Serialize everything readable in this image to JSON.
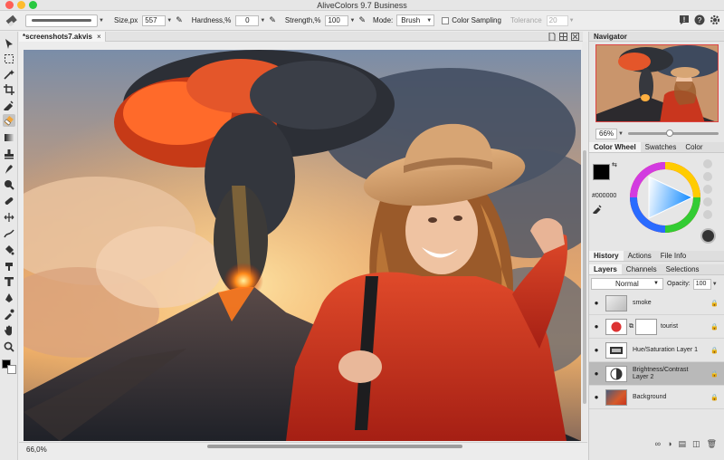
{
  "window": {
    "title": "AliveColors 9.7 Business"
  },
  "options_bar": {
    "size_label": "Size,px",
    "size_value": "557",
    "hardness_label": "Hardness,%",
    "hardness_value": "0",
    "strength_label": "Strength,%",
    "strength_value": "100",
    "mode_label": "Mode:",
    "mode_value": "Brush",
    "color_sampling_label": "Color Sampling",
    "tolerance_label": "Tolerance",
    "tolerance_value": "20"
  },
  "document": {
    "tab_title": "*screenshots7.akvis",
    "tab_close": "×",
    "zoom": "66,0%"
  },
  "navigator": {
    "title": "Navigator",
    "zoom_value": "66%"
  },
  "color_panel": {
    "tabs": [
      "Color Wheel",
      "Swatches",
      "Color"
    ],
    "hex_value": "#000000"
  },
  "history_panel": {
    "tabs": [
      "History",
      "Actions",
      "File Info"
    ]
  },
  "layers_panel": {
    "tabs": [
      "Layers",
      "Channels",
      "Selections"
    ],
    "blend_mode": "Normal",
    "opacity_label": "Opacity:",
    "opacity_value": "100",
    "layers": [
      {
        "name": "smoke"
      },
      {
        "name": "tourist"
      },
      {
        "name": "Hue/Saturation Layer 1"
      },
      {
        "name": "Brightness/Contrast Layer 2"
      },
      {
        "name": "Background"
      }
    ]
  },
  "colors": {
    "accent": "#2f6bd8",
    "fire": "#ff5a1a",
    "sweater": "#d2341f"
  }
}
